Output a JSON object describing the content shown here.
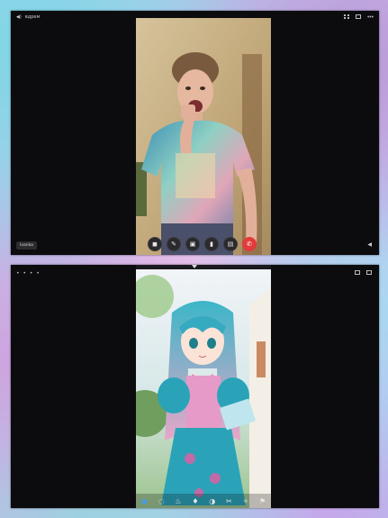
{
  "top_window": {
    "title": "вдрем",
    "name_tag": "Ivanka",
    "call_controls": [
      {
        "icon": "camera-icon",
        "glyph": "◼"
      },
      {
        "icon": "pen-icon",
        "glyph": "✎"
      },
      {
        "icon": "screen-share-icon",
        "glyph": "▣"
      },
      {
        "icon": "microphone-icon",
        "glyph": "▮"
      },
      {
        "icon": "chat-icon",
        "glyph": "▤"
      },
      {
        "icon": "end-call-icon",
        "glyph": "✆"
      }
    ],
    "speaker_glyph": "◀"
  },
  "bottom_window": {
    "dots": "• • • •",
    "toolbar": [
      {
        "icon": "eye-icon",
        "glyph": "◉",
        "accent": true
      },
      {
        "icon": "lasso-icon",
        "glyph": "◌"
      },
      {
        "icon": "flame-icon",
        "glyph": "♨"
      },
      {
        "icon": "drop-icon",
        "glyph": "♦"
      },
      {
        "icon": "fill-icon",
        "glyph": "◑"
      },
      {
        "icon": "scissors-icon",
        "glyph": "✂"
      },
      {
        "icon": "sparkle-icon",
        "glyph": "✧"
      },
      {
        "icon": "flag-icon",
        "glyph": "⚑"
      }
    ]
  },
  "colors": {
    "panel": "#0c0c0e",
    "end_call": "#e23b3b",
    "accent": "#3aa0ff"
  }
}
